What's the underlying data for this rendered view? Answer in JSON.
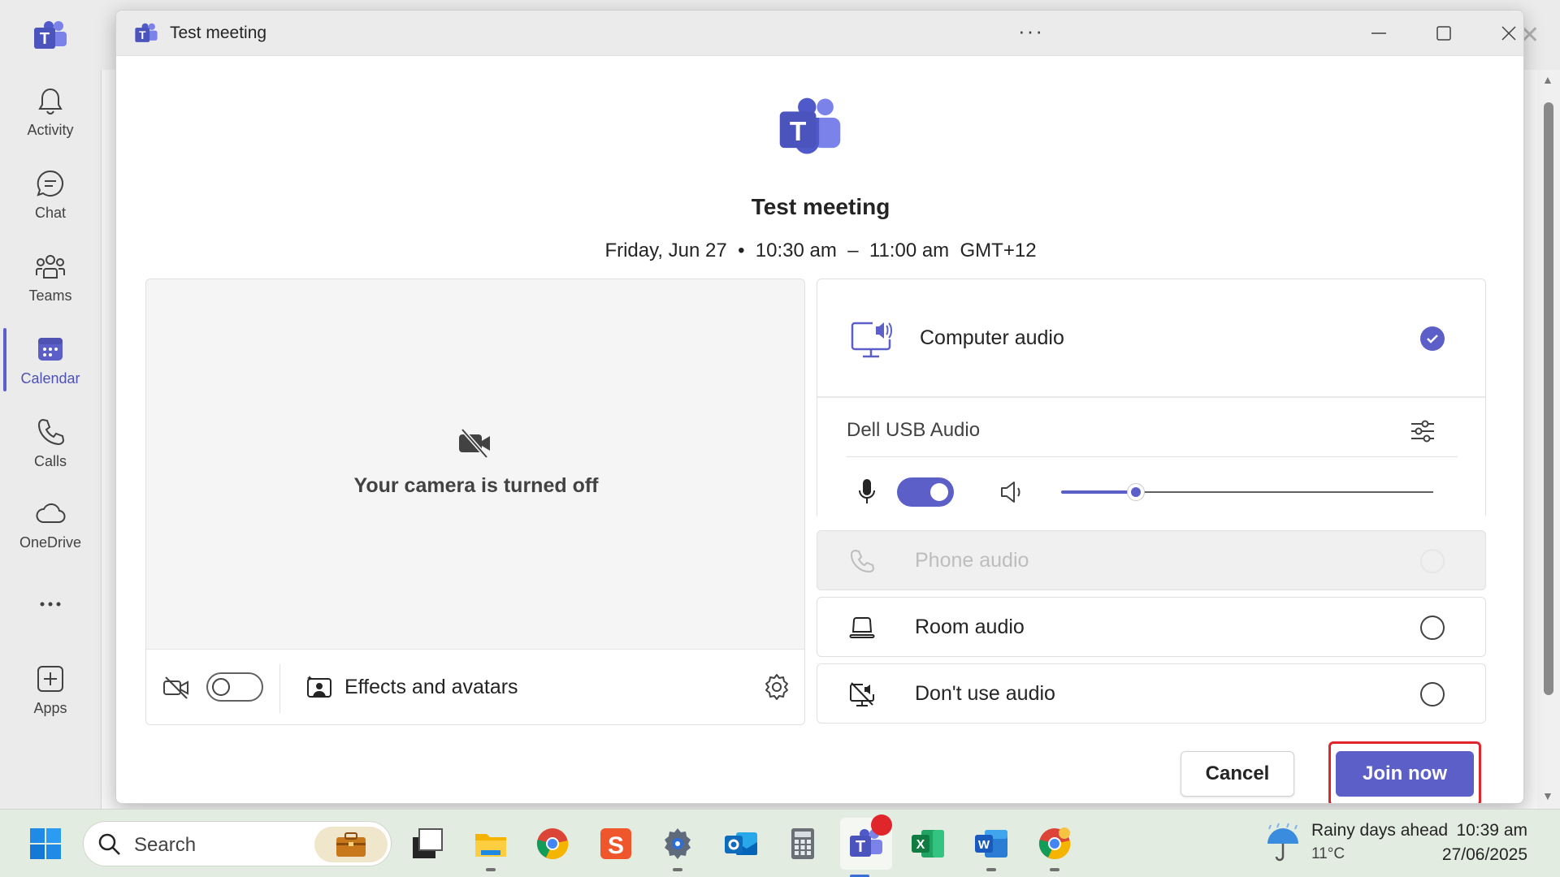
{
  "rail": {
    "items": [
      {
        "label": "Activity",
        "icon": "bell-icon"
      },
      {
        "label": "Chat",
        "icon": "chat-icon"
      },
      {
        "label": "Teams",
        "icon": "teams-people-icon"
      },
      {
        "label": "Calendar",
        "icon": "calendar-icon",
        "active": true
      },
      {
        "label": "Calls",
        "icon": "phone-icon"
      },
      {
        "label": "OneDrive",
        "icon": "cloud-icon"
      },
      {
        "label": "",
        "icon": "more-icon"
      },
      {
        "label": "Apps",
        "icon": "add-app-icon"
      }
    ]
  },
  "window": {
    "title": "Test meeting",
    "more": "···"
  },
  "meeting": {
    "title": "Test meeting",
    "when": "Friday, Jun 27  •  10:30 am  –  11:00 am  GMT+12"
  },
  "video": {
    "camera_off_text": "Your camera is turned off",
    "effects_label": "Effects and avatars",
    "camera_on": false
  },
  "audio": {
    "computer_audio": "Computer audio",
    "device_name": "Dell USB Audio",
    "mic_on": true,
    "volume": 0.2,
    "options": [
      {
        "label": "Phone audio",
        "icon": "phone-icon",
        "disabled": true
      },
      {
        "label": "Room audio",
        "icon": "room-audio-icon",
        "disabled": false
      },
      {
        "label": "Don't use audio",
        "icon": "no-audio-icon",
        "disabled": false
      }
    ]
  },
  "buttons": {
    "cancel": "Cancel",
    "join": "Join now"
  },
  "taskbar": {
    "search_placeholder": "Search",
    "apps": [
      "file-explorer-icon",
      "chrome-icon",
      "sogou-icon",
      "settings-icon",
      "outlook-icon",
      "calculator-icon",
      "teams-icon",
      "excel-icon",
      "word-icon",
      "chrome-icon"
    ],
    "weather_title": "Rainy days ahead",
    "weather_temp": "11°C",
    "time": "10:39 am",
    "date": "27/06/2025"
  },
  "colors": {
    "accent": "#5b5fc7",
    "highlight": "#e0252b"
  }
}
